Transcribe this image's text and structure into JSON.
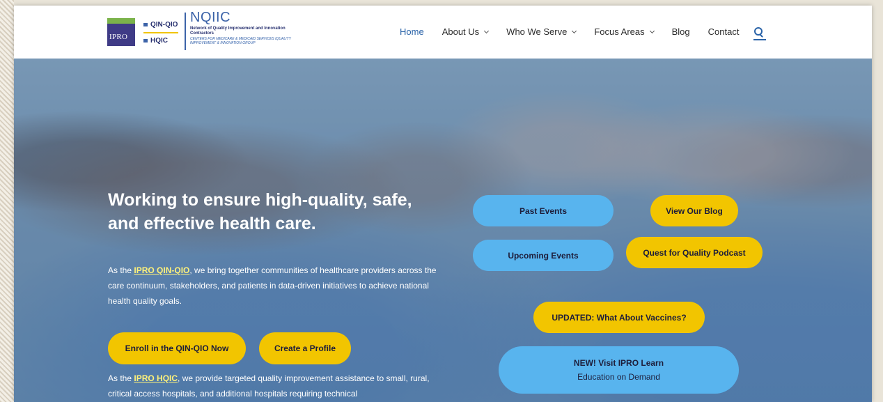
{
  "header": {
    "logo": {
      "ipro": "IPRO",
      "qin_qio": "QIN-QIO",
      "hqic": "HQIC",
      "nqiic_title": "NQIIC",
      "nqiic_subtitle": "Network of Quality Improvement and Innovation Contractors",
      "cms_text": "CENTERS FOR MEDICARE & MEDICAID SERVICES IQUALITY IMPROVEMENT & INNOVATION GROUP"
    },
    "nav": [
      {
        "label": "Home",
        "active": true
      },
      {
        "label": "About Us",
        "dropdown": true
      },
      {
        "label": "Who We Serve",
        "dropdown": true
      },
      {
        "label": "Focus Areas",
        "dropdown": true
      },
      {
        "label": "Blog"
      },
      {
        "label": "Contact"
      }
    ],
    "search_icon": "search-icon"
  },
  "hero": {
    "headline": "Working to ensure high-quality, safe, and effective health care.",
    "p1": {
      "prefix": "As the ",
      "link": "IPRO QIN-QIO",
      "suffix": ", we bring together communities of healthcare providers across the care continuum, stakeholders, and patients in data-driven initiatives to achieve national health quality goals."
    },
    "p2": {
      "prefix": "As the ",
      "link": "IPRO HQIC",
      "suffix": ", we provide targeted quality improvement assistance to small, rural, critical access hospitals, and additional hospitals requiring technical"
    },
    "buttons": {
      "enroll": "Enroll in the QIN-QIO Now",
      "profile": "Create a Profile",
      "past_events": "Past Events",
      "view_blog": "View Our Blog",
      "upcoming_events": "Upcoming Events",
      "podcast": "Quest for Quality Podcast",
      "vaccines": "UPDATED: What About Vaccines?",
      "learn_title": "NEW! Visit IPRO Learn",
      "learn_sub": "Education on Demand"
    }
  },
  "colors": {
    "accent_yellow": "#f2c500",
    "accent_blue": "#58b4ee",
    "nav_active": "#2a63a8",
    "link_yellow": "#fff27a"
  }
}
